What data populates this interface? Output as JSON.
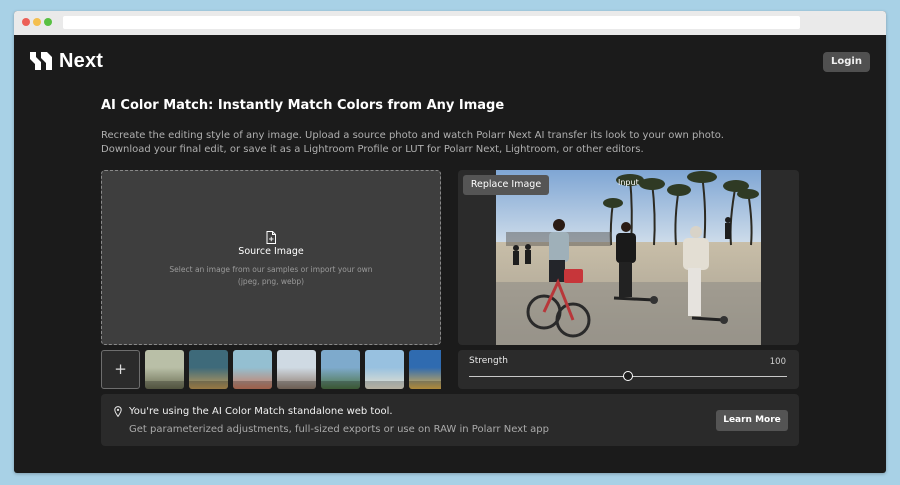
{
  "header": {
    "brand_name": "Next",
    "login_label": "Login"
  },
  "main": {
    "title": "AI Color Match: Instantly Match Colors from Any Image",
    "description_line1": "Recreate the editing style of any image. Upload a source photo and watch Polarr Next AI transfer its look to your own photo.",
    "description_line2": "Download your final edit, or save it as a Lightroom Profile or LUT for Polarr Next, Lightroom, or other editors."
  },
  "source": {
    "title": "Source Image",
    "subtitle_line1": "Select an image from our samples or import your own",
    "subtitle_line2": "(jpeg, png, webp)",
    "add_label": "+",
    "samples": [
      {
        "name": "sample-1",
        "colors": [
          "#b9bfa7",
          "#6a6d52"
        ]
      },
      {
        "name": "sample-2",
        "colors": [
          "#3e6a7a",
          "#c29b57"
        ]
      },
      {
        "name": "sample-3",
        "colors": [
          "#94bfd1",
          "#cd7b5f"
        ]
      },
      {
        "name": "sample-4",
        "colors": [
          "#cfdae3",
          "#8d7a6c"
        ]
      },
      {
        "name": "sample-5",
        "colors": [
          "#7eaacc",
          "#4d7344"
        ]
      },
      {
        "name": "sample-6",
        "colors": [
          "#98c1e0",
          "#eae3cf"
        ]
      },
      {
        "name": "sample-7",
        "colors": [
          "#2f6bb0",
          "#e2b24b"
        ]
      }
    ]
  },
  "preview": {
    "replace_label": "Replace Image",
    "input_label": "Input"
  },
  "strength": {
    "label": "Strength",
    "value": "100",
    "level": 0.5
  },
  "banner": {
    "line1": "You're using the AI Color Match standalone web tool.",
    "line2": "Get parameterized adjustments, full-sized exports or use on RAW in Polarr Next app",
    "button_label": "Learn More"
  },
  "icons": {
    "brand": "brand-logo-icon",
    "file": "file-icon",
    "pin": "location-pin-icon"
  }
}
